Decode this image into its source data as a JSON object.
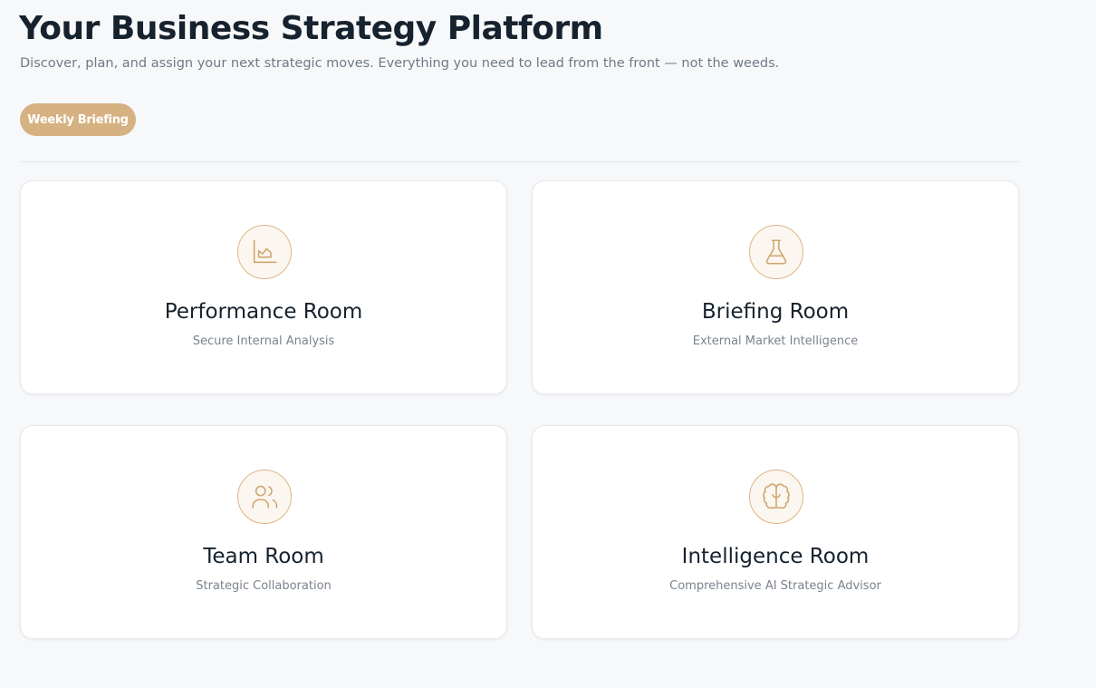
{
  "header": {
    "title": "Your Business Strategy Platform",
    "subtitle": "Discover, plan, and assign your next strategic moves. Everything you need to lead from the front — not the weeds."
  },
  "actions": {
    "weekly_briefing_label": "Weekly Briefing"
  },
  "colors": {
    "accent": "#d6b182",
    "icon_stroke": "#d0a56f",
    "icon_bg": "#fbf6ef",
    "background": "#f7f8fa",
    "title_text": "#16222e",
    "muted_text": "#7a838e"
  },
  "rooms": [
    {
      "title": "Performance Room",
      "subtitle": "Secure Internal Analysis",
      "icon": "area-chart-icon"
    },
    {
      "title": "Briefing Room",
      "subtitle": "External Market Intelligence",
      "icon": "flask-icon"
    },
    {
      "title": "Team Room",
      "subtitle": "Strategic Collaboration",
      "icon": "users-icon"
    },
    {
      "title": "Intelligence Room",
      "subtitle": "Comprehensive AI Strategic Advisor",
      "icon": "brain-icon"
    }
  ]
}
